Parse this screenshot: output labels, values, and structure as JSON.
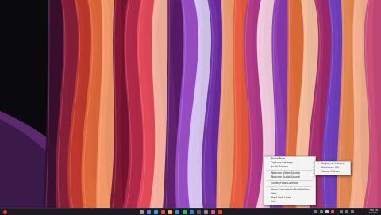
{
  "context_menu": {
    "items": [
      {
        "label": "Pause Rule",
        "checked": false,
        "submenu": false
      },
      {
        "label": "Capture Settings",
        "checked": false,
        "submenu": true
      },
      {
        "label": "Audio Source",
        "checked": false,
        "submenu": true
      },
      {
        "sep": true
      },
      {
        "label": "Webcam Video Source",
        "checked": false,
        "submenu": true
      },
      {
        "label": "Webcam Audio Source",
        "checked": false,
        "submenu": true
      },
      {
        "sep": true
      },
      {
        "label": "Enable/Hide Controls",
        "checked": false,
        "submenu": false
      },
      {
        "sep": true
      },
      {
        "label": "Show Connection Notification",
        "checked": false,
        "submenu": false
      },
      {
        "label": "Help",
        "checked": false,
        "submenu": false
      },
      {
        "label": "Start Link Links",
        "checked": false,
        "submenu": false
      },
      {
        "label": "Exit",
        "checked": false,
        "submenu": false
      }
    ]
  },
  "submenu": {
    "items": [
      {
        "label": "Region of Interest",
        "checked": true
      },
      {
        "label": "Configure Ref",
        "checked": false
      },
      {
        "label": "Mouse Pointer",
        "checked": false
      }
    ]
  },
  "taskbar": {
    "clock_time": "7:59 AM",
    "clock_date": "12/2/2022",
    "icons": [
      {
        "name": "search-icon",
        "color": "#9a9aa6"
      },
      {
        "name": "task-view-icon",
        "color": "#6f7fd6"
      },
      {
        "name": "edge-icon",
        "color": "#2fa6d9"
      },
      {
        "name": "chrome-icon",
        "color": "#e24a3b"
      },
      {
        "name": "file-explorer-icon",
        "color": "#e8b93a"
      },
      {
        "name": "store-icon",
        "color": "#3a8fe0"
      },
      {
        "name": "spotify-icon",
        "color": "#22c35d"
      },
      {
        "name": "vscode-icon",
        "color": "#2e86d4"
      },
      {
        "name": "terminal-icon",
        "color": "#5d5d6a"
      },
      {
        "name": "settings-icon",
        "color": "#8b8b95"
      },
      {
        "name": "photos-icon",
        "color": "#d65a8a"
      },
      {
        "name": "recorder-icon",
        "color": "#d94b2b"
      }
    ]
  }
}
